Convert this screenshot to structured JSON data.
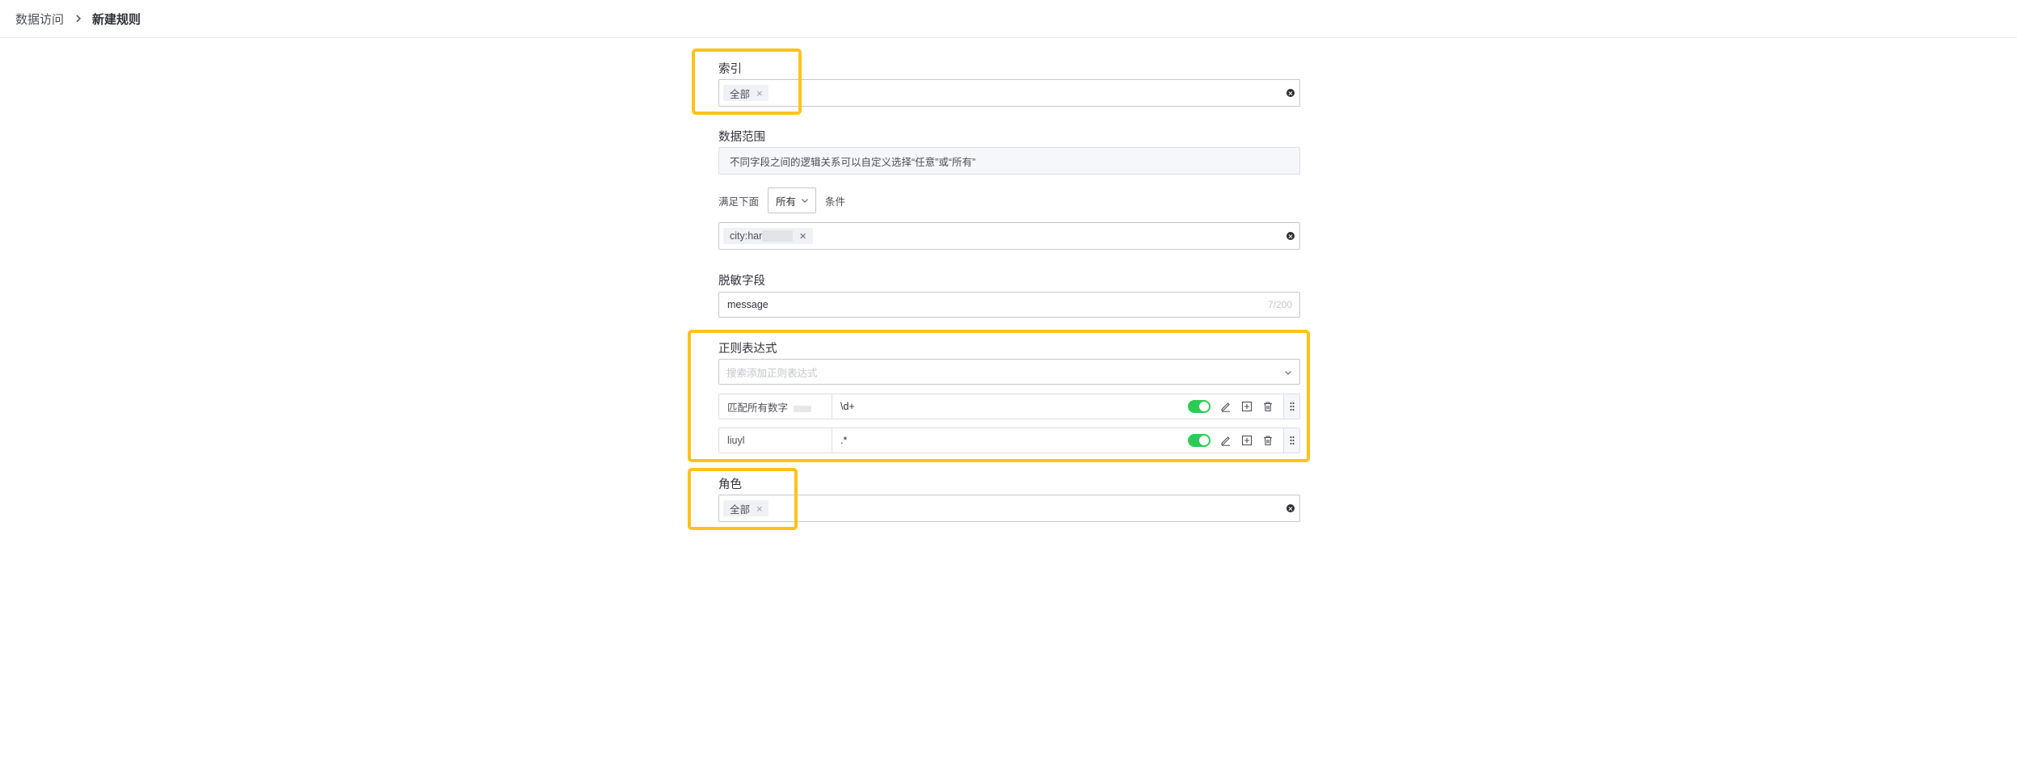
{
  "breadcrumb": {
    "parent": "数据访问",
    "current": "新建规则"
  },
  "index": {
    "label": "索引",
    "tag": "全部"
  },
  "data_range": {
    "label": "数据范围",
    "tip": "不同字段之间的逻辑关系可以自定义选择“任意”或“所有”",
    "prefix": "满足下面",
    "operator": "所有",
    "suffix": "条件",
    "condition_tag": "city:har"
  },
  "mask_field": {
    "label": "脱敏字段",
    "value": "message",
    "count": "7/200"
  },
  "regex": {
    "label": "正则表达式",
    "placeholder": "搜索添加正则表达式",
    "rows": [
      {
        "name": "匹配所有数字",
        "pattern": "\\d+",
        "enabled": true
      },
      {
        "name": "liuyl",
        "pattern": ".*",
        "enabled": true
      }
    ]
  },
  "role": {
    "label": "角色",
    "tag": "全部"
  },
  "colors": {
    "highlight": "#ffc21a",
    "toggle_on": "#2dcb56"
  }
}
